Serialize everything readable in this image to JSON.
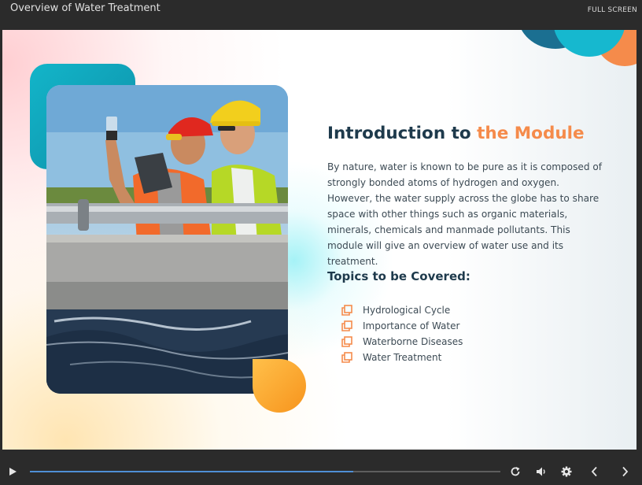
{
  "window": {
    "title": "Overview of Water Treatment",
    "fullscreen_label": "FULL SCREEN"
  },
  "slide": {
    "heading_main": "Introduction to ",
    "heading_accent": "the Module",
    "body": "By nature, water is known to be pure as it is composed of strongly bonded atoms of hydrogen and oxygen. However, the water supply across the globe has to share space with other things such as organic materials, minerals, chemicals and manmade pollutants. This module will give an overview of water use and its treatment.",
    "topics_title": "Topics to be Covered:",
    "topics": [
      "Hydrological Cycle",
      "Importance of Water",
      "Waterborne Diseases",
      "Water Treatment"
    ]
  },
  "player": {
    "progress_fraction": 0.687,
    "icons": [
      "play-icon",
      "replay-icon",
      "volume-icon",
      "settings-icon",
      "previous-icon",
      "next-icon"
    ]
  },
  "colors": {
    "accent": "#f58b4b",
    "heading": "#1e3a4c",
    "progress": "#4f8fd6",
    "teal": "#12b5c9"
  }
}
